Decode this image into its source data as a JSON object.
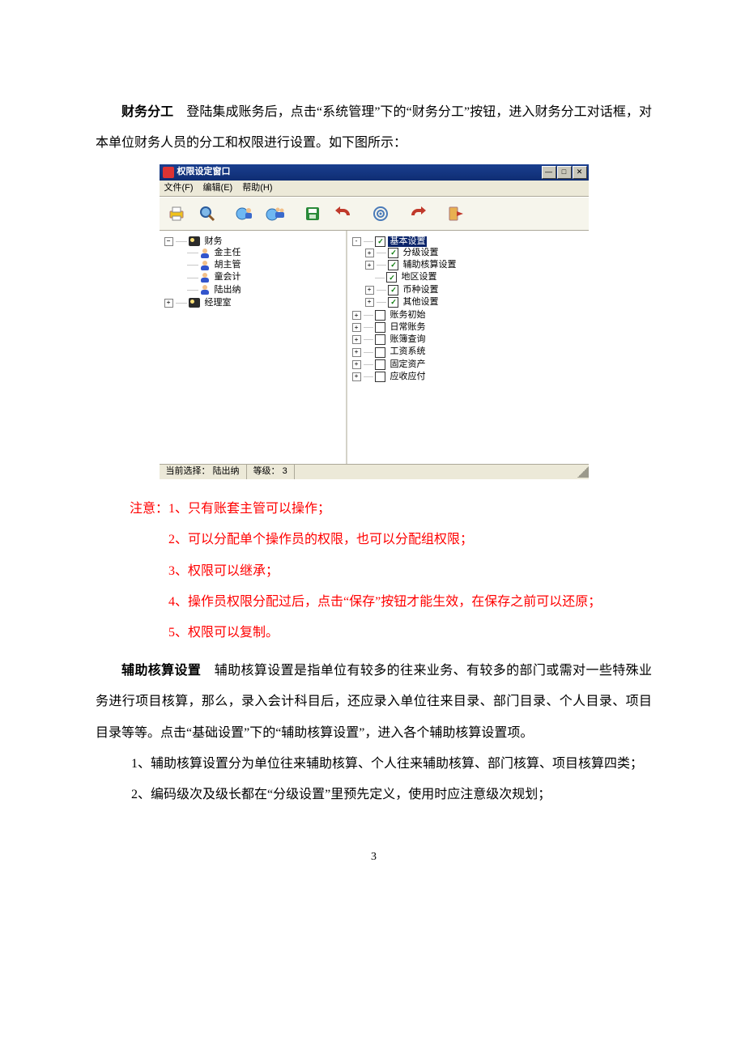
{
  "doc": {
    "p1_bold": "财务分工",
    "p1_rest": "　登陆集成账务后，点击“系统管理”下的“财务分工”按钮，进入财务分工对话框，对本单位财务人员的分工和权限进行设置。如下图所示：",
    "notes_lead": "注意：1、只有账套主管可以操作；",
    "notes": [
      "2、可以分配单个操作员的权限，也可以分配组权限；",
      "3、权限可以继承；",
      "4、操作员权限分配过后，点击“保存”按钮才能生效，在保存之前可以还原；",
      "5、权限可以复制。"
    ],
    "p2_bold": "辅助核算设置",
    "p2_rest": "　辅助核算设置是指单位有较多的往来业务、有较多的部门或需对一些特殊业务进行项目核算，那么，录入会计科目后，还应录入单位往来目录、部门目录、个人目录、项目目录等等。点击“基础设置”下的“辅助核算设置”，进入各个辅助核算设置项。",
    "li1": "1、辅助核算设置分为单位往来辅助核算、个人往来辅助核算、部门核算、项目核算四类；",
    "li2": "2、编码级次及级长都在“分级设置”里预先定义，使用时应注意级次规划；",
    "page_number": "3"
  },
  "app": {
    "title": "权限设定窗口",
    "menus": {
      "file": "文件(F)",
      "edit": "编辑(E)",
      "help": "帮助(H)"
    },
    "status": {
      "label1": "当前选择：",
      "value1": "陆出纳",
      "label2": "等级：",
      "value2": "3"
    },
    "left_tree": {
      "root": "财务",
      "children": [
        "金主任",
        "胡主管",
        "童会计",
        "陆出纳"
      ],
      "sibling": "经理室"
    },
    "right_tree": [
      {
        "label": "基本设置",
        "exp": "-",
        "chk": true,
        "sel": true,
        "children": [
          {
            "label": "分级设置",
            "exp": "+",
            "chk": true
          },
          {
            "label": "辅助核算设置",
            "exp": "+",
            "chk": true
          },
          {
            "label": "地区设置",
            "exp": "",
            "chk": true
          },
          {
            "label": "币种设置",
            "exp": "+",
            "chk": true
          },
          {
            "label": "其他设置",
            "exp": "+",
            "chk": true
          }
        ]
      },
      {
        "label": "账务初始",
        "exp": "+",
        "chk": false
      },
      {
        "label": "日常账务",
        "exp": "+",
        "chk": false
      },
      {
        "label": "账簿查询",
        "exp": "+",
        "chk": false
      },
      {
        "label": "工资系统",
        "exp": "+",
        "chk": false
      },
      {
        "label": "固定资产",
        "exp": "+",
        "chk": false
      },
      {
        "label": "应收应付",
        "exp": "+",
        "chk": false
      }
    ],
    "toolbar_icons": [
      "printer",
      "magnifier",
      "globe-user",
      "globe-users",
      "disk",
      "undo",
      "",
      "target",
      "eraser",
      "exit"
    ]
  }
}
